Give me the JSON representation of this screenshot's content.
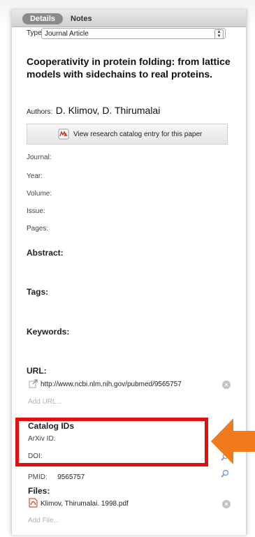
{
  "tabs": {
    "details": "Details",
    "notes": "Notes"
  },
  "type": {
    "label": "Type:",
    "value": "Journal Article"
  },
  "title": "Cooperativity in protein folding: from lattice models with sidechains to real proteins.",
  "authors": {
    "label": "Authors:",
    "value": "D. Klimov, D. Thirumalai"
  },
  "catalog_button": "View research catalog entry for this paper",
  "fields": {
    "journal": "Journal:",
    "year": "Year:",
    "volume": "Volume:",
    "issue": "Issue:",
    "pages": "Pages:"
  },
  "sections": {
    "abstract": "Abstract:",
    "tags": "Tags:",
    "keywords": "Keywords:",
    "url": "URL:",
    "catalog_ids": "Catalog IDs",
    "files": "Files:"
  },
  "url": {
    "value": "http://www.ncbi.nlm.nih.gov/pubmed/9565757",
    "add": "Add URL..."
  },
  "catalog_ids": {
    "arxiv_label": "ArXiv ID:",
    "doi_label": "DOI:",
    "pmid_label": "PMID:",
    "pmid_value": "9565757"
  },
  "files": {
    "name": "Klimov, Thirumalai. 1998.pdf",
    "add": "Add File..."
  },
  "colors": {
    "highlight": "#e01010",
    "arrow": "#f07a1c"
  }
}
